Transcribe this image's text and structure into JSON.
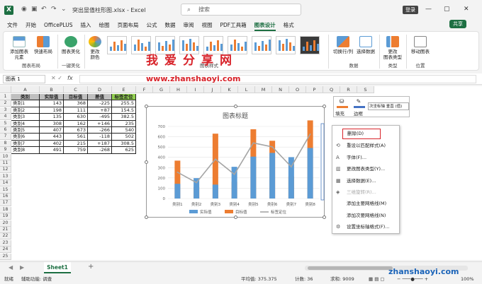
{
  "app": {
    "logo": "X",
    "doc_title": "突出显值柱形图.xlsx - Excel",
    "search_placeholder": "搜索",
    "login": "登录",
    "share": "共享"
  },
  "menu": [
    "文件",
    "开始",
    "OfficePLUS",
    "插入",
    "绘图",
    "页面布局",
    "公式",
    "数据",
    "审阅",
    "视图",
    "PDF工具箱",
    "图表设计",
    "格式"
  ],
  "menu_active": "图表设计",
  "ribbon": {
    "add_element": "添加图表\n元素",
    "quick_layout": "快速布局",
    "chart_beautify": "图表美化",
    "change_color": "更改\n颜色",
    "switch_rowcol": "切换行/列",
    "select_data": "选择数据",
    "change_type": "更改\n图表类型",
    "move_chart": "移动图表",
    "group_layout": "图表布局",
    "group_beautify": "一键美化",
    "group_styles": "图表样式",
    "group_data": "数据",
    "group_type": "类型",
    "group_location": "位置"
  },
  "formula_bar": {
    "name_box": "图表 1",
    "fx": "fx"
  },
  "watermarks": {
    "title": "我爱分享网",
    "url": "www.zhanshaoyi.com",
    "corner": "zhanshaoyi.com"
  },
  "columns": [
    "A",
    "B",
    "C",
    "D",
    "E",
    "F",
    "G",
    "H",
    "I",
    "J",
    "K",
    "L",
    "M",
    "N",
    "O",
    "P",
    "Q",
    "R",
    "S"
  ],
  "table": {
    "headers": [
      "类别",
      "实际值",
      "目标值",
      "差值",
      "标签定位"
    ],
    "rows": [
      [
        "类别1",
        "143",
        "368",
        "-225",
        "255.5"
      ],
      [
        "类别2",
        "198",
        "111",
        "+87",
        "154.5"
      ],
      [
        "类别3",
        "135",
        "630",
        "-495",
        "382.5"
      ],
      [
        "类别4",
        "308",
        "162",
        "+146",
        "235"
      ],
      [
        "类别5",
        "407",
        "673",
        "-266",
        "540"
      ],
      [
        "类别6",
        "443",
        "561",
        "-118",
        "502"
      ],
      [
        "类别7",
        "402",
        "215",
        "+187",
        "308.5"
      ],
      [
        "类别8",
        "491",
        "759",
        "-268",
        "625"
      ]
    ]
  },
  "chart_data": {
    "type": "bar",
    "title": "图表标题",
    "categories": [
      "类别1",
      "类别2",
      "类别3",
      "类别4",
      "类别5",
      "类别6",
      "类别7",
      "类别8"
    ],
    "series": [
      {
        "name": "实际值",
        "type": "bar",
        "color": "#5b9bd5",
        "values": [
          143,
          198,
          135,
          308,
          407,
          443,
          402,
          491
        ]
      },
      {
        "name": "目标值",
        "type": "bar",
        "color": "#ed7d31",
        "values": [
          368,
          111,
          630,
          162,
          673,
          561,
          215,
          759
        ]
      },
      {
        "name": "标签定位",
        "type": "line",
        "color": "#a5a5a5",
        "values": [
          255.5,
          154.5,
          382.5,
          235,
          540,
          502,
          308.5,
          625
        ]
      }
    ],
    "yticks": [
      "0",
      "100",
      "200",
      "300",
      "400",
      "500",
      "600",
      "700"
    ],
    "ylim": [
      0,
      700
    ],
    "legend": "bottom",
    "grid": true
  },
  "mini_toolbar": {
    "fill": "填充",
    "outline": "边框",
    "series_select": "次坐标轴 垂直 (值)"
  },
  "context_menu": [
    {
      "label": "删除(D)",
      "icon": "",
      "disabled": false,
      "highlight": true
    },
    {
      "label": "重设以匹配样式(A)",
      "icon": "reset-icon",
      "disabled": false
    },
    {
      "label": "字体(F)...",
      "icon": "font-icon",
      "disabled": false
    },
    {
      "label": "更改图表类型(Y)...",
      "icon": "chart-type-icon",
      "disabled": false
    },
    {
      "label": "选择数据(E)...",
      "icon": "data-icon",
      "disabled": false
    },
    {
      "label": "三维旋转(R)...",
      "icon": "rotate-icon",
      "disabled": true
    },
    {
      "label": "添加主要网格线(M)",
      "icon": "",
      "disabled": false
    },
    {
      "label": "添加次要网格线(N)",
      "icon": "",
      "disabled": false
    },
    {
      "label": "设置坐标轴格式(F)...",
      "icon": "format-axis-icon",
      "disabled": false
    }
  ],
  "sheet": {
    "tab": "Sheet1",
    "add": "+"
  },
  "status": {
    "ready": "就绪",
    "accessibility": "辅助功能: 调查",
    "avg": "平均值: 375.375",
    "count": "计数: 36",
    "sum": "求和: 9009",
    "zoom": "100%"
  }
}
